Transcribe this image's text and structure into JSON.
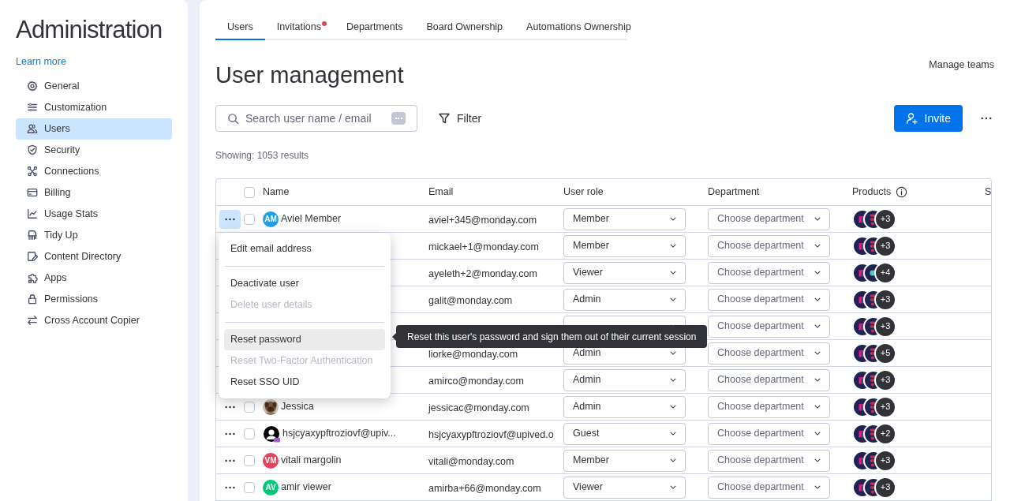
{
  "sidebar": {
    "title": "Administration",
    "learn_more": "Learn more",
    "items": [
      {
        "label": "General",
        "selected": false
      },
      {
        "label": "Customization",
        "selected": false
      },
      {
        "label": "Users",
        "selected": true
      },
      {
        "label": "Security",
        "selected": false
      },
      {
        "label": "Connections",
        "selected": false
      },
      {
        "label": "Billing",
        "selected": false
      },
      {
        "label": "Usage Stats",
        "selected": false
      },
      {
        "label": "Tidy Up",
        "selected": false
      },
      {
        "label": "Content Directory",
        "selected": false
      },
      {
        "label": "Apps",
        "selected": false
      },
      {
        "label": "Permissions",
        "selected": false
      },
      {
        "label": "Cross Account Copier",
        "selected": false
      }
    ]
  },
  "tabs": [
    {
      "label": "Users",
      "selected": true,
      "badge": false
    },
    {
      "label": "Invitations",
      "selected": false,
      "badge": true
    },
    {
      "label": "Departments",
      "selected": false,
      "badge": false
    },
    {
      "label": "Board Ownership",
      "selected": false,
      "badge": false
    },
    {
      "label": "Automations Ownership",
      "selected": false,
      "badge": false
    }
  ],
  "page_title": "User management",
  "manage_teams": "Manage teams",
  "search": {
    "placeholder": "Search user name / email"
  },
  "filter": "Filter",
  "invite": "Invite",
  "results": "Showing: 1053 results",
  "table": {
    "columns": [
      "Name",
      "Email",
      "User role",
      "Department",
      "Products",
      "S"
    ],
    "header_checked": false,
    "rows": [
      {
        "menu_open": true,
        "checked": false,
        "avatar": {
          "kind": "initials",
          "text": "AM",
          "color": "#1e9fe6"
        },
        "name": "Aviel Member",
        "email": "aviel+345@monday.com",
        "role": "Member",
        "department": "Choose department",
        "products": {
          "icons": [
            {
              "kind": "work"
            },
            {
              "kind": "stack"
            }
          ],
          "more": "+3"
        }
      },
      {
        "email": "mickael+1@monday.com",
        "role": "Member",
        "department": "Choose department",
        "products": {
          "icons": [
            {
              "kind": "work"
            },
            {
              "kind": "stack"
            }
          ],
          "more": "+3"
        }
      },
      {
        "email": "ayeleth+2@monday.com",
        "role": "Viewer",
        "department": "Choose department",
        "products": {
          "icons": [
            {
              "kind": "work"
            },
            {
              "kind": "dot"
            }
          ],
          "more": "+4"
        }
      },
      {
        "email": "galit@monday.com",
        "role": "Admin",
        "department": "Choose department",
        "products": {
          "icons": [
            {
              "kind": "work"
            },
            {
              "kind": "stack"
            }
          ],
          "more": "+3"
        }
      },
      {
        "department": "Choose department",
        "products": {
          "icons": [
            {
              "kind": "work"
            },
            {
              "kind": "stack"
            }
          ],
          "more": "+3"
        }
      },
      {
        "email": "liorke@monday.com",
        "role": "Admin",
        "department": "Choose department",
        "products": {
          "icons": [
            {
              "kind": "work"
            },
            {
              "kind": "stack"
            }
          ],
          "more": "+5"
        }
      },
      {
        "email": "amirco@monday.com",
        "role": "Admin",
        "department": "Choose department",
        "products": {
          "icons": [
            {
              "kind": "work"
            },
            {
              "kind": "stack"
            }
          ],
          "more": "+3"
        }
      },
      {
        "menu_open": false,
        "checked": false,
        "name": "Jessica",
        "email": "jessicac@monday.com",
        "role": "Admin",
        "department": "Choose department",
        "products": {
          "icons": [
            {
              "kind": "work"
            },
            {
              "kind": "stack"
            }
          ],
          "more": "+3"
        }
      },
      {
        "menu_open": false,
        "checked": false,
        "avatar": {
          "kind": "silhouette"
        },
        "name": "hsjcyaxypftroziovf@upiv...",
        "email": "hsjcyaxypftroziovf@upived.o",
        "role": "Guest",
        "department": "Choose department",
        "products": {
          "icons": [
            {
              "kind": "work"
            },
            {
              "kind": "stack"
            }
          ],
          "more": "+2"
        }
      },
      {
        "menu_open": false,
        "checked": false,
        "avatar": {
          "kind": "initials",
          "text": "VM",
          "color": "#e2445c"
        },
        "name": "vitali margolin",
        "email": "vitali@monday.com",
        "role": "Member",
        "department": "Choose department",
        "products": {
          "icons": [
            {
              "kind": "work"
            },
            {
              "kind": "stack"
            }
          ],
          "more": "+3"
        }
      },
      {
        "menu_open": false,
        "checked": false,
        "avatar": {
          "kind": "initials",
          "text": "AV",
          "color": "#00c875"
        },
        "name": "amir viewer",
        "email": "amirba+66@monday.com",
        "role": "Viewer",
        "department": "Choose department",
        "products": {
          "icons": [
            {
              "kind": "work"
            },
            {
              "kind": "stack"
            }
          ],
          "more": "+3"
        }
      }
    ]
  },
  "row_menu": {
    "groups": [
      [
        {
          "label": "Edit email address",
          "disabled": false,
          "highlighted": false
        }
      ],
      [
        {
          "label": "Deactivate user",
          "disabled": false,
          "highlighted": false
        },
        {
          "label": "Delete user details",
          "disabled": true,
          "highlighted": false
        }
      ],
      [
        {
          "label": "Reset password",
          "disabled": false,
          "highlighted": true
        },
        {
          "label": "Reset Two-Factor Authentication",
          "disabled": true,
          "highlighted": false
        },
        {
          "label": "Reset SSO UID",
          "disabled": false,
          "highlighted": false
        }
      ]
    ]
  },
  "tooltip": "Reset this user's password and sign them out of their current session"
}
